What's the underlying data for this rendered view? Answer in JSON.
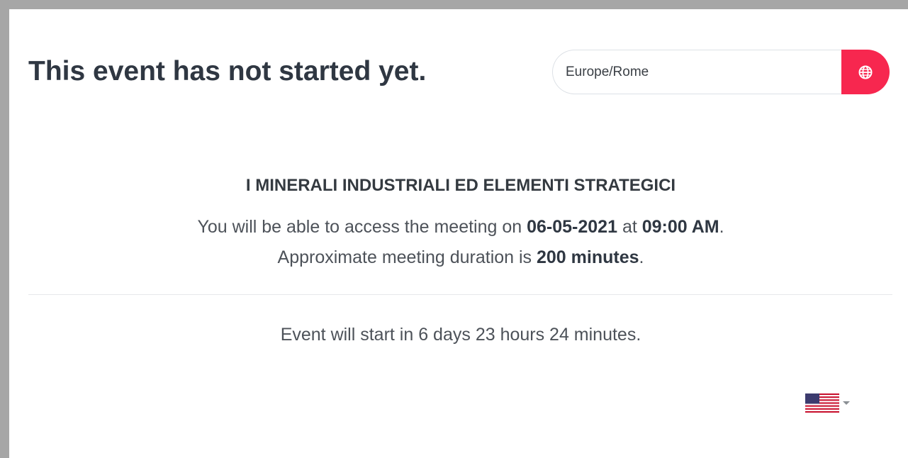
{
  "header": {
    "title": "This event has not started yet."
  },
  "timezone": {
    "value": "Europe/Rome",
    "button_icon": "globe-icon",
    "accent_color": "#f7274f"
  },
  "event": {
    "name": "I MINERALI INDUSTRIALI ED ELEMENTI STRATEGICI",
    "access_prefix": "You will be able to access the meeting on ",
    "access_date": "06-05-2021",
    "access_at": " at ",
    "access_time": "09:00 AM",
    "access_suffix": ".",
    "duration_prefix": "Approximate meeting duration is ",
    "duration_value": "200 minutes",
    "duration_suffix": "."
  },
  "countdown": {
    "text": "Event will start in 6 days 23 hours 24 minutes."
  },
  "language": {
    "flag_icon": "us-flag-icon",
    "dropdown_icon": "caret-down-icon"
  }
}
